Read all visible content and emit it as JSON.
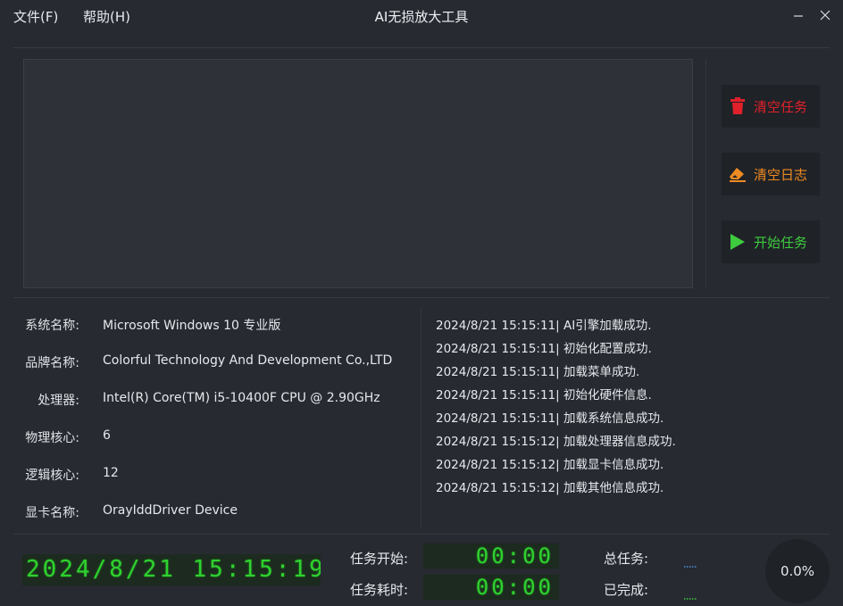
{
  "menu": {
    "file": "文件(F)",
    "help": "帮助(H)"
  },
  "window": {
    "title": "AI无损放大工具"
  },
  "actions": {
    "clear_tasks": "清空任务",
    "clear_log": "清空日志",
    "start_task": "开始任务"
  },
  "colors": {
    "clear_tasks": "#e0202a",
    "clear_log": "#f08a22",
    "start_task": "#3ecb3e",
    "led": "#2fd12f"
  },
  "system_info": [
    {
      "label": "系统名称:",
      "value": "Microsoft Windows 10 专业版"
    },
    {
      "label": "品牌名称:",
      "value": "Colorful Technology And Development Co.,LTD"
    },
    {
      "label": "处理器:",
      "value": "Intel(R) Core(TM) i5-10400F CPU @ 2.90GHz"
    },
    {
      "label": "物理核心:",
      "value": "6"
    },
    {
      "label": "逻辑核心:",
      "value": "12"
    },
    {
      "label": "显卡名称:",
      "value": "OrayIddDriver Device"
    }
  ],
  "log": [
    "2024/8/21 15:15:11| AI引擎加载成功.",
    "2024/8/21 15:15:11| 初始化配置成功.",
    "2024/8/21 15:15:11| 加载菜单成功.",
    "2024/8/21 15:15:11| 初始化硬件信息.",
    "2024/8/21 15:15:11| 加载系统信息成功.",
    "2024/8/21 15:15:12| 加载处理器信息成功.",
    "2024/8/21 15:15:12| 加载显卡信息成功.",
    "2024/8/21 15:15:12| 加载其他信息成功."
  ],
  "status": {
    "clock": "2024/8/21 15:15:19",
    "task_start_label": "任务开始:",
    "task_start_value": "00:00",
    "task_elapsed_label": "任务耗时:",
    "task_elapsed_value": "00:00",
    "total_tasks_label": "总任务:",
    "completed_label": "已完成:",
    "progress": "0.0%"
  }
}
